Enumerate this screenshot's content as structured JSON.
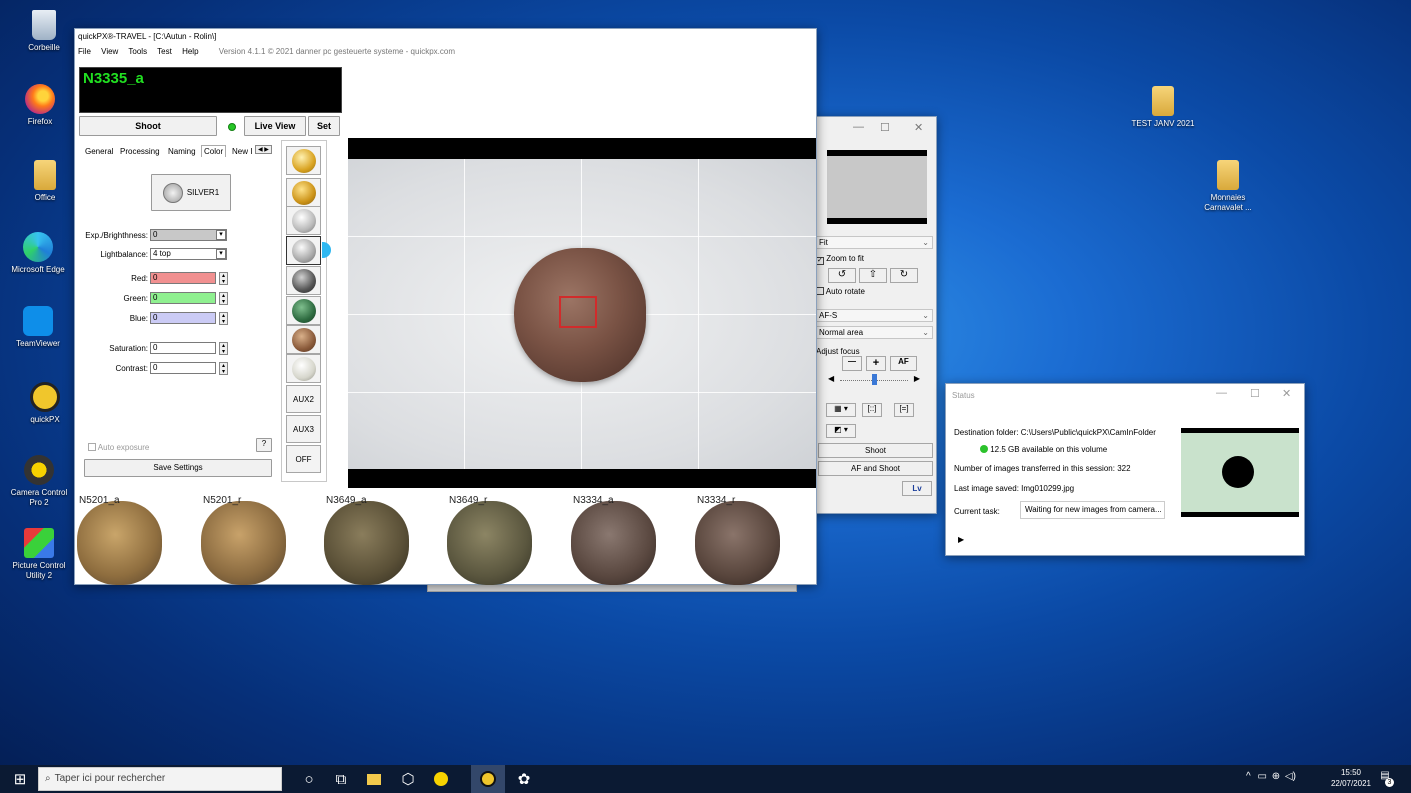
{
  "desktop": {
    "icons": [
      "Corbeille",
      "Firefox",
      "Office",
      "Microsoft Edge",
      "TeamViewer",
      "quickPX",
      "Camera Control Pro 2",
      "Picture Control Utility 2"
    ],
    "folders": [
      "TEST JANV 2021",
      "Monnaies Carnavalet ..."
    ]
  },
  "main": {
    "title": "quickPX®-TRAVEL - [C:\\Autun - Rolin\\]",
    "menu": [
      "File",
      "View",
      "Tools",
      "Test",
      "Help"
    ],
    "version": "Version 4.1.1  © 2021 danner pc gesteuerte systeme - quickpx.com",
    "image_name": "N3335_a",
    "buttons": {
      "shoot": "Shoot",
      "live_view": "Live View",
      "set": "Set",
      "silver": "SILVER1",
      "save_settings": "Save Settings",
      "help": "?",
      "aux2": "AUX2",
      "aux3": "AUX3",
      "off": "OFF"
    },
    "tabs": [
      "General",
      "Processing",
      "Naming",
      "Color",
      "New I"
    ],
    "fields": {
      "exposure_label": "Exp./Brighthness:",
      "exposure_value": "0",
      "lightbalance_label": "Lightbalance:",
      "lightbalance_value": "4 top",
      "red_label": "Red:",
      "red_value": "0",
      "green_label": "Green:",
      "green_value": "0",
      "blue_label": "Blue:",
      "blue_value": "0",
      "saturation_label": "Saturation:",
      "saturation_value": "0",
      "contrast_label": "Contrast:",
      "contrast_value": "0",
      "auto_exposure": "Auto exposure"
    },
    "thumbnails": [
      "N5201_a",
      "N5201_r",
      "N3649_a",
      "N3649_r",
      "N3334_a",
      "N3334_r"
    ]
  },
  "live_panel": {
    "fit": "Fit",
    "zoom_to_fit": "Zoom to fit",
    "auto_rotate": "Auto rotate",
    "af_mode": "AF-S",
    "area": "Normal area",
    "adjust_focus": "Adjust focus",
    "minus": "—",
    "plus": "+",
    "af": "AF",
    "shoot": "Shoot",
    "af_and_shoot": "AF and Shoot",
    "lv": "Lv"
  },
  "status": {
    "title": "Status",
    "dest_label": "Destination folder:",
    "dest_value": "C:\\Users\\Public\\quickPX\\CamInFolder",
    "space": "12.5 GB  available on this volume",
    "transferred_label": "Number of images transferred in this session:",
    "transferred_value": "322",
    "last_label": "Last image saved:",
    "last_value": "Img010299.jpg",
    "task_label": "Current task:",
    "task_value": "Waiting for new images from camera..."
  },
  "taskbar": {
    "search": "Taper ici pour rechercher",
    "time": "15:50",
    "date": "22/07/2021",
    "notifications": "3"
  },
  "colors": {
    "accent_green": "#21e021",
    "red_field": "#f19090",
    "green_field": "#8ff090",
    "blue_field": "#cbcbf5"
  }
}
